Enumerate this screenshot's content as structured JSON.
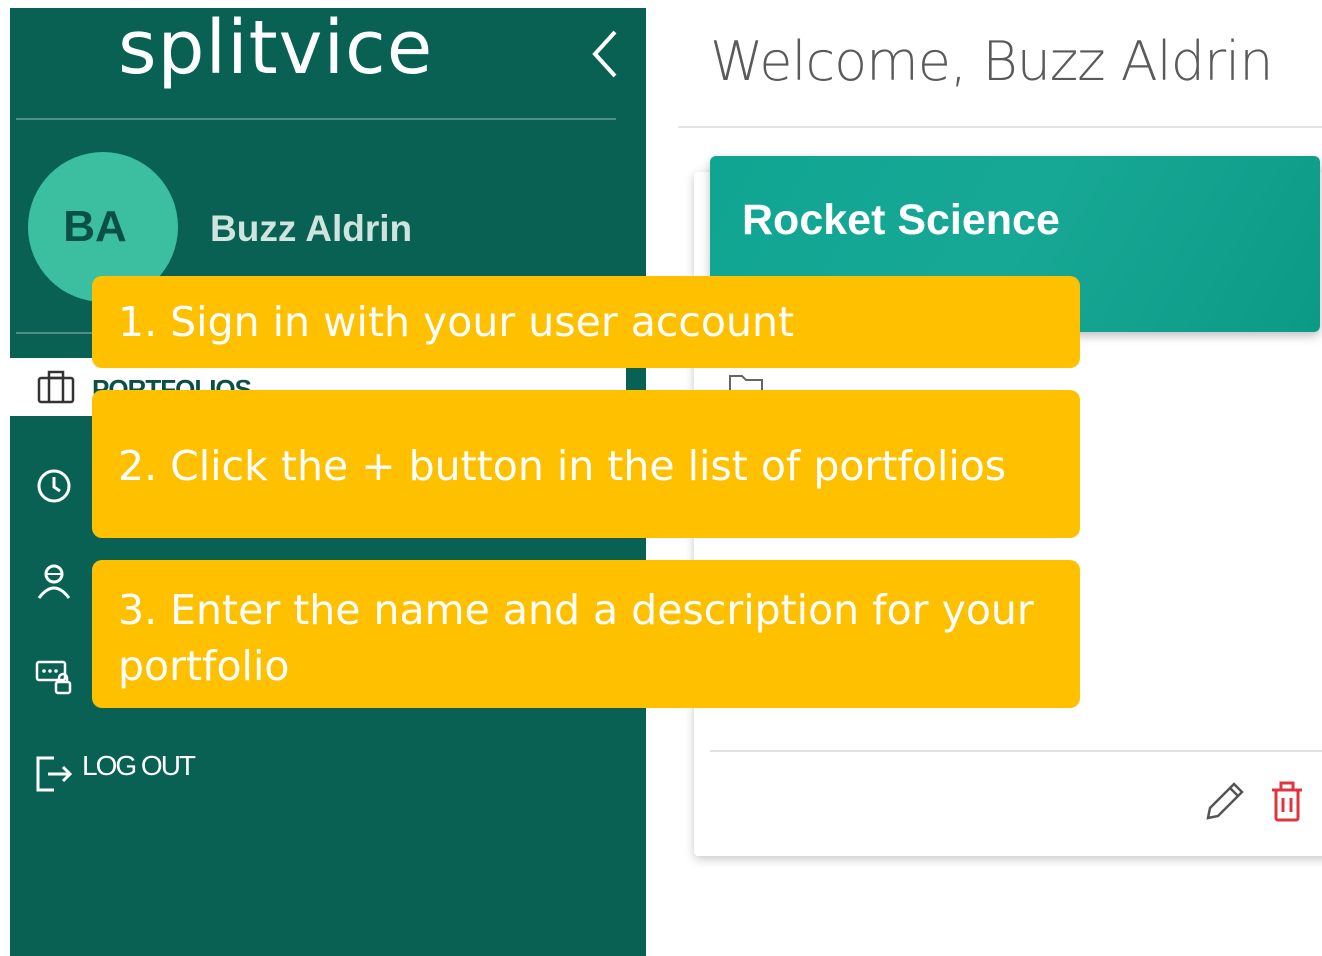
{
  "app": {
    "logo_text": "splitvice",
    "colors": {
      "sidebar": "#086152",
      "accent": "#17a895",
      "callout": "#ffc000",
      "danger": "#e0343f"
    }
  },
  "sidebar": {
    "user": {
      "initials": "BA",
      "name": "Buzz Aldrin"
    },
    "nav": [
      {
        "label": "PORTFOLIOS",
        "icon": "briefcase-icon",
        "active": true
      },
      {
        "label": "",
        "icon": "clock-icon"
      },
      {
        "label": "",
        "icon": "user-icon"
      },
      {
        "label": "",
        "icon": "api-key-lock-icon"
      }
    ],
    "logout": {
      "label": "LOG OUT",
      "icon": "logout-icon"
    }
  },
  "main": {
    "welcome": "Welcome, Buzz Aldrin",
    "card": {
      "title": "Rocket Science"
    }
  },
  "callouts": [
    "1. Sign in with your user account",
    "2. Click the + button in the list of portfolios",
    "3. Enter the name and a description for your portfolio"
  ]
}
